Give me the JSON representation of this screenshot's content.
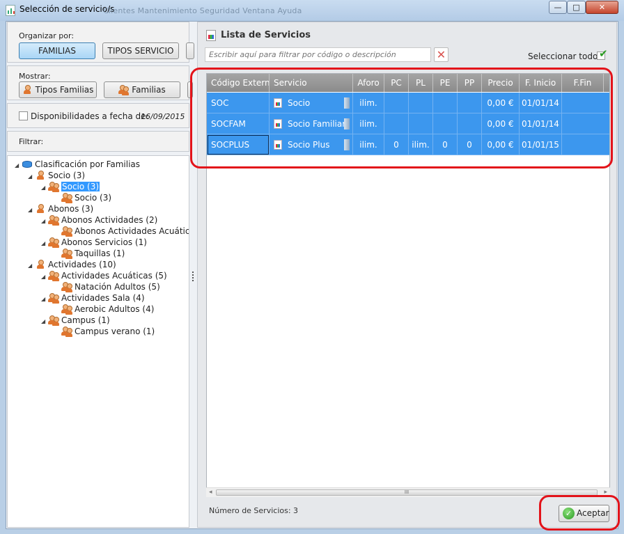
{
  "window": {
    "title": "Selección de servicio/s",
    "ghost_menu": "Clientes    Mantenimiento    Seguridad    Ventana    Ayuda",
    "minimize": "—",
    "maximize": "□",
    "close": "✕"
  },
  "left": {
    "organize_label": "Organizar por:",
    "organize_buttons": [
      "FAMILIAS",
      "TIPOS SERVICIO"
    ],
    "show_label": "Mostrar:",
    "show_buttons": [
      "Tipos Familias",
      "Familias"
    ],
    "availability_label": "Disponibilidades a fecha de:",
    "availability_date": "16/09/2015",
    "filter_label": "Filtrar:",
    "tree": [
      {
        "label": "Clasificación por Familias",
        "level": 0
      },
      {
        "label": "Socio (3)",
        "level": 1
      },
      {
        "label": "Socio (3)",
        "level": 2,
        "selected": true
      },
      {
        "label": "Socio (3)",
        "level": 3
      },
      {
        "label": "Abonos (3)",
        "level": 1
      },
      {
        "label": "Abonos Actividades (2)",
        "level": 2
      },
      {
        "label": "Abonos Actividades Acuáticas",
        "level": 3
      },
      {
        "label": "Abonos Servicios (1)",
        "level": 2
      },
      {
        "label": "Taquillas (1)",
        "level": 3
      },
      {
        "label": "Actividades (10)",
        "level": 1
      },
      {
        "label": "Actividades Acuáticas (5)",
        "level": 2
      },
      {
        "label": "Natación Adultos (5)",
        "level": 3
      },
      {
        "label": "Actividades Sala (4)",
        "level": 2
      },
      {
        "label": "Aerobic Adultos (4)",
        "level": 3
      },
      {
        "label": "Campus (1)",
        "level": 2
      },
      {
        "label": "Campus verano (1)",
        "level": 3
      }
    ]
  },
  "right": {
    "title": "Lista de Servicios",
    "filter_placeholder": "Escribir aquí para filtrar por código o descripción",
    "select_all": "Seleccionar todos",
    "columns": [
      "Código Externo",
      "Servicio",
      "Aforo",
      "PC",
      "PL",
      "PE",
      "PP",
      "Precio",
      "F. Inicio",
      "F.Fin"
    ],
    "rows": [
      [
        "SOC",
        "Socio",
        "ilim.",
        "",
        "",
        "",
        "",
        "0,00 €",
        "01/01/14",
        ""
      ],
      [
        "SOCFAM",
        "Socio Familiar",
        "ilim.",
        "",
        "",
        "",
        "",
        "0,00 €",
        "01/01/14",
        ""
      ],
      [
        "SOCPLUS",
        "Socio Plus",
        "ilim.",
        "0",
        "ilim.",
        "0",
        "0",
        "0,00 €",
        "01/01/15",
        ""
      ]
    ],
    "scroll_left": "◂",
    "scroll_right": "▸",
    "scroll_grip": "III",
    "count_label": "Número de Servicios: 3",
    "accept": "Aceptar"
  },
  "colors": {
    "selection": "#3c97ee",
    "header": "#999999",
    "highlight": "#e3131a"
  }
}
